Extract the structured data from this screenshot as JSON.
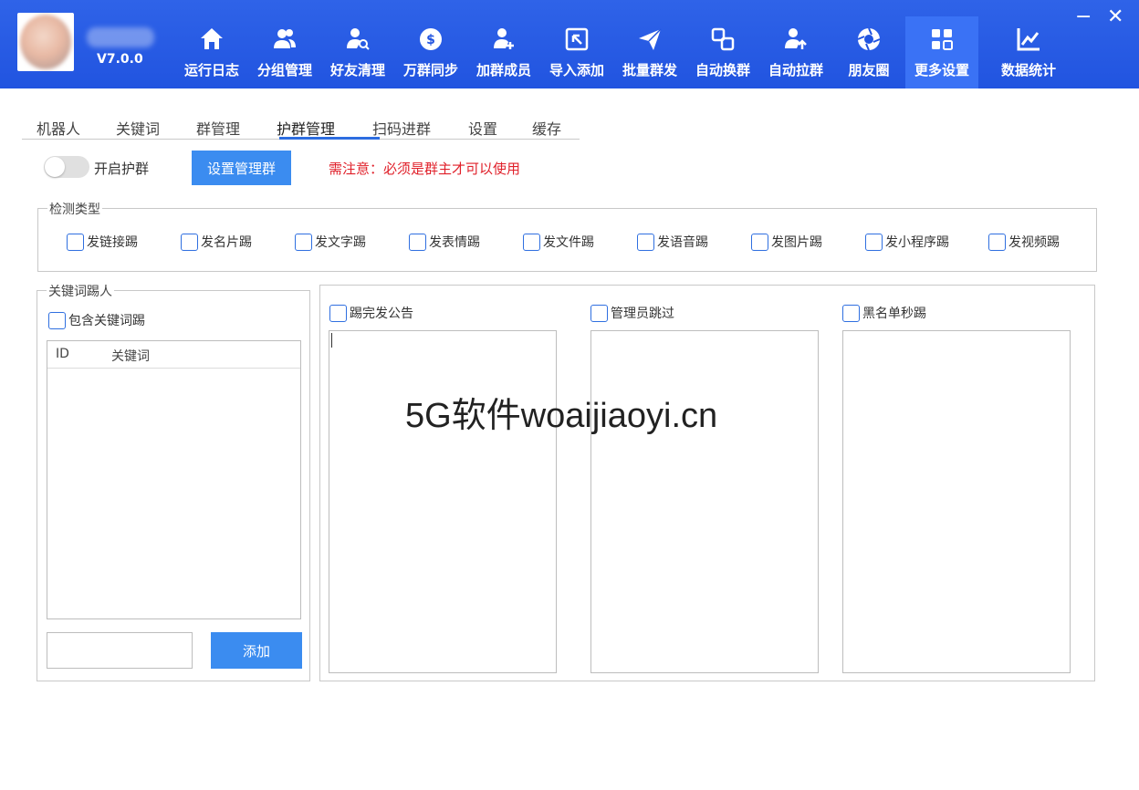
{
  "header": {
    "version": "V7.0.0",
    "nav": [
      {
        "label": "运行日志",
        "icon": "home-icon"
      },
      {
        "label": "分组管理",
        "icon": "users-icon"
      },
      {
        "label": "好友清理",
        "icon": "user-search-icon"
      },
      {
        "label": "万群同步",
        "icon": "sync-icon"
      },
      {
        "label": "加群成员",
        "icon": "user-add-icon"
      },
      {
        "label": "导入添加",
        "icon": "import-icon"
      },
      {
        "label": "批量群发",
        "icon": "send-icon"
      },
      {
        "label": "自动换群",
        "icon": "swap-icon"
      },
      {
        "label": "自动拉群",
        "icon": "user-pull-icon"
      },
      {
        "label": "朋友圈",
        "icon": "aperture-icon"
      },
      {
        "label": "更多设置",
        "icon": "grid-icon"
      },
      {
        "label": "数据统计",
        "icon": "chart-icon"
      }
    ],
    "active_nav": "更多设置",
    "minimize": "−",
    "close": "✕"
  },
  "tabs": [
    "机器人",
    "关键词",
    "群管理",
    "护群管理",
    "扫码进群",
    "设置",
    "缓存"
  ],
  "active_tab": "护群管理",
  "guard": {
    "toggle_label": "开启护群",
    "toggle_on": false,
    "set_admin_group_button": "设置管理群",
    "warning": "需注意：必须是群主才可以使用"
  },
  "detect": {
    "title": "检测类型",
    "options": [
      "发链接踢",
      "发名片踢",
      "发文字踢",
      "发表情踢",
      "发文件踢",
      "发语音踢",
      "发图片踢",
      "发小程序踢",
      "发视频踢"
    ]
  },
  "keyword_kick": {
    "title": "关键词踢人",
    "checkbox": "包含关键词踢",
    "columns": [
      "ID",
      "关键词"
    ],
    "add_button": "添加",
    "input_value": ""
  },
  "panels": {
    "announce_checkbox": "踢完发公告",
    "admin_skip_checkbox": "管理员跳过",
    "blacklist_checkbox": "黑名单秒踢"
  },
  "watermark": "5G软件woaijiaoyi.cn",
  "colors": {
    "header_blue": "#2154e0",
    "active_nav": "#3a72f5",
    "button_blue": "#3b8cf0",
    "warning_red": "#e0202a"
  }
}
